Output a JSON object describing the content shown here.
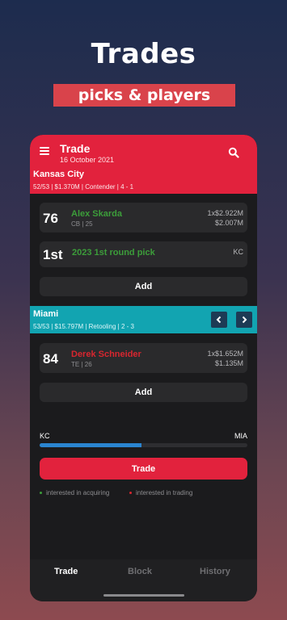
{
  "promo": {
    "title": "Trades",
    "subtitle": "picks & players"
  },
  "header": {
    "title": "Trade",
    "date": "16 October 2021"
  },
  "team_kc": {
    "name": "Kansas City",
    "info": "52/53 | $1.370M | Contender | 4 - 1",
    "color": "#e2223d",
    "assets": [
      {
        "number": "76",
        "name": "Alex Skarda",
        "meta": "CB | 25",
        "amount_top": "1x$2.922M",
        "amount_bottom": "$2.007M"
      },
      {
        "number": "1st",
        "name": "2023 1st round pick",
        "amount_top": "KC"
      }
    ],
    "add_label": "Add"
  },
  "team_mia": {
    "name": "Miami",
    "info": "53/53 | $15.797M | Retooling | 2 - 3",
    "color": "#12a4b1",
    "assets": [
      {
        "number": "84",
        "name": "Derek Schneider",
        "meta": "TE | 26",
        "amount_top": "1x$1.652M",
        "amount_bottom": "$1.135M"
      }
    ],
    "add_label": "Add"
  },
  "balance": {
    "left_label": "KC",
    "right_label": "MIA",
    "left_share": 0.49
  },
  "trade_button": "Trade",
  "legend": {
    "acquiring": "interested in acquiring",
    "trading": "interested in trading",
    "acquiring_color": "#3c9d3a",
    "trading_color": "#d8262f"
  },
  "tabs": [
    "Trade",
    "Block",
    "History"
  ],
  "icons": [
    "menu-icon",
    "search-icon",
    "chevron-left-icon",
    "chevron-right-icon"
  ]
}
